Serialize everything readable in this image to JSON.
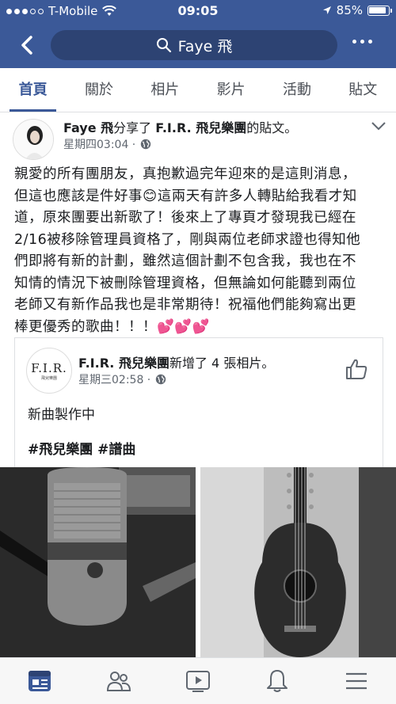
{
  "status_bar": {
    "carrier": "T-Mobile",
    "time": "09:05",
    "battery": "85%"
  },
  "header": {
    "search_text": "Faye 飛"
  },
  "tabs": [
    {
      "label": "首頁",
      "active": true
    },
    {
      "label": "關於"
    },
    {
      "label": "相片"
    },
    {
      "label": "影片"
    },
    {
      "label": "活動"
    },
    {
      "label": "貼文"
    }
  ],
  "post": {
    "author": "Faye 飛",
    "action": "分享了",
    "shared_from": "F.I.R. 飛兒樂團",
    "action_suffix": "的貼文。",
    "timestamp": "星期四03:04 ·",
    "text_lines": [
      "親愛的所有團朋友，真抱歉過完年迎來的是這則消息，",
      "但這也應該是件好事😊這兩天有許多人轉貼給我看才知",
      "道，原來團要出新歌了！後來上了專頁才發現我已經在",
      "2/16被移除管理員資格了，剛與兩位老師求證也得知他",
      "們即將有新的計劃，雖然這個計劃不包含我，我也在不",
      "知情的情況下被刪除管理資格，但無論如何能聽到兩位",
      "老師又有新作品我也是非常期待！祝福他們能夠寫出更",
      "棒更優秀的歌曲！！！💕💕💕"
    ]
  },
  "shared_card": {
    "avatar_text": "F.I.R.",
    "avatar_subtext": "飛兒樂團",
    "page_name": "F.I.R. 飛兒樂團",
    "action": "新增了 4 張相片。",
    "timestamp": "星期三02:58 ·",
    "text": "新曲製作中",
    "tags": "#飛兒樂團 #譜曲"
  },
  "bottom_nav": [
    {
      "icon": "news-feed-icon",
      "active": true
    },
    {
      "icon": "groups-icon"
    },
    {
      "icon": "watch-icon"
    },
    {
      "icon": "notifications-icon"
    },
    {
      "icon": "menu-icon"
    }
  ],
  "colors": {
    "brand": "#3b5998",
    "text": "#1c1e21",
    "muted": "#606770"
  }
}
